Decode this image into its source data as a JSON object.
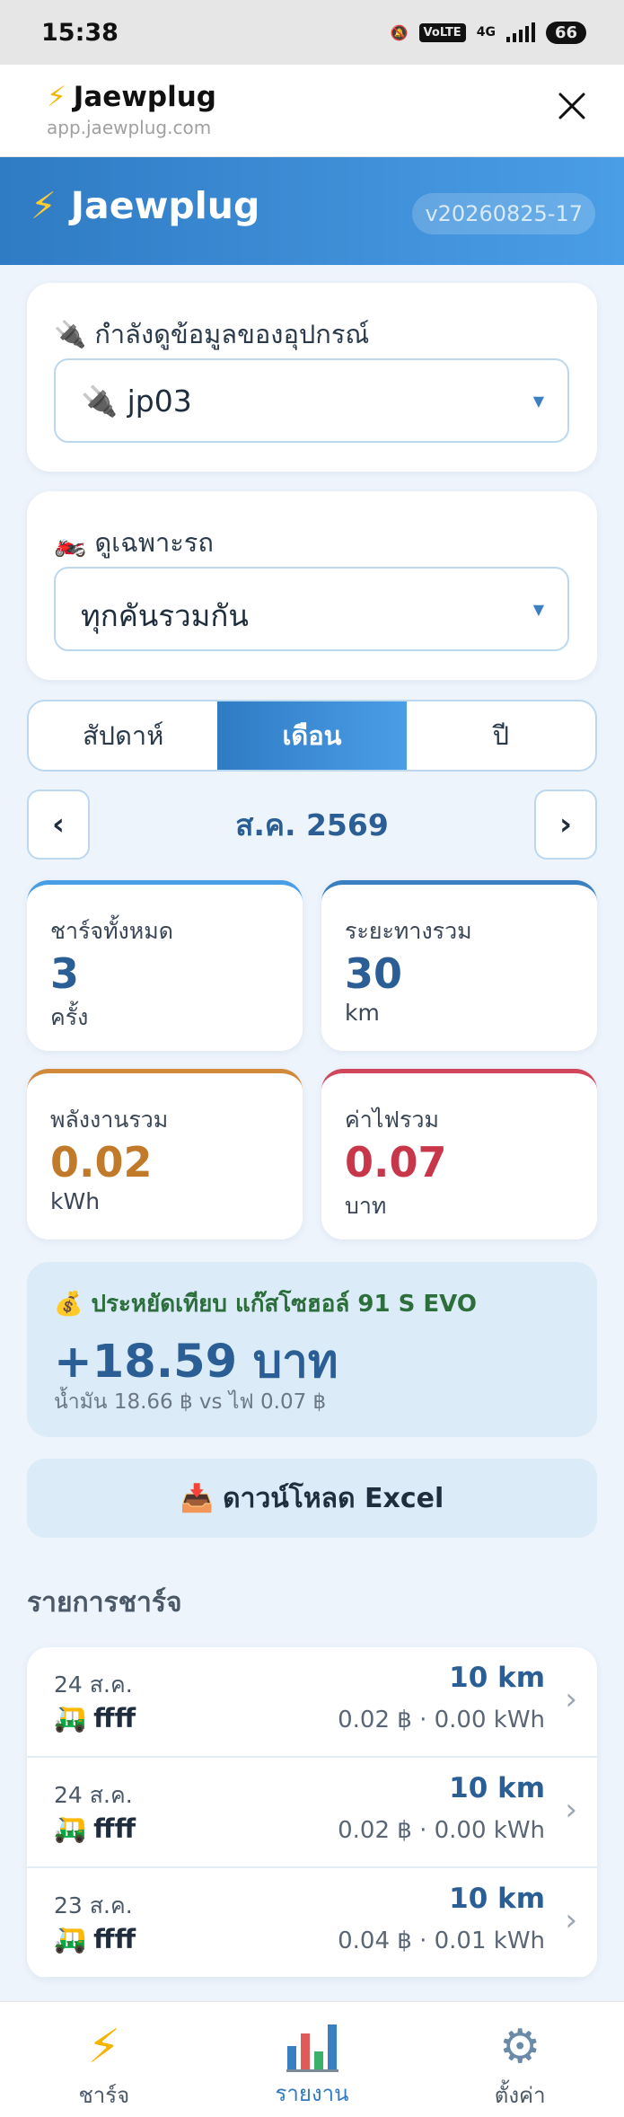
{
  "status_bar": {
    "time": "15:38",
    "network": "4G",
    "volte": "VoLTE",
    "battery": "66"
  },
  "browser": {
    "title": "Jaewplug",
    "url": "app.jaewplug.com"
  },
  "app_header": {
    "title": "Jaewplug",
    "version": "v20260825-17"
  },
  "device_card": {
    "label": "กำลังดูข้อมูลของอุปกรณ์",
    "selected": "jp03"
  },
  "vehicle_card": {
    "label": "ดูเฉพาะรถ",
    "selected": "ทุกคันรวมกัน"
  },
  "period_tabs": [
    {
      "label": "สัปดาห์",
      "active": false
    },
    {
      "label": "เดือน",
      "active": true
    },
    {
      "label": "ปี",
      "active": false
    }
  ],
  "month_nav": {
    "prev": "‹",
    "label": "ส.ค. 2569",
    "next": "›"
  },
  "stats": {
    "charges": {
      "label": "ชาร์จทั้งหมด",
      "value": "3",
      "unit": "ครั้ง",
      "color": "#2a5e94"
    },
    "distance": {
      "label": "ระยะทางรวม",
      "value": "30",
      "unit": "km",
      "color": "#2a5e94"
    },
    "energy": {
      "label": "พลังงานรวม",
      "value": "0.02",
      "unit": "kWh",
      "color": "#c07a2a"
    },
    "cost": {
      "label": "ค่าไฟรวม",
      "value": "0.07",
      "unit": "บาท",
      "color": "#c8364a"
    }
  },
  "savings": {
    "title": "ประหยัดเทียบ แก๊สโซฮอล์ 91 S EVO",
    "amount": "+18.59 บาท",
    "detail": "น้ำมัน 18.66 ฿ vs ไฟ 0.07 ฿"
  },
  "download": {
    "label": "ดาวน์โหลด Excel"
  },
  "charge_list": {
    "title": "รายการชาร์จ",
    "items": [
      {
        "date": "24 ส.ค.",
        "vehicle": "ffff",
        "distance": "10 km",
        "detail": "0.02 ฿ · 0.00 kWh"
      },
      {
        "date": "24 ส.ค.",
        "vehicle": "ffff",
        "distance": "10 km",
        "detail": "0.02 ฿ · 0.00 kWh"
      },
      {
        "date": "23 ส.ค.",
        "vehicle": "ffff",
        "distance": "10 km",
        "detail": "0.04 ฿ · 0.01 kWh"
      }
    ]
  },
  "bottom_nav": [
    {
      "label": "ชาร์จ",
      "icon": "lightning-icon",
      "active": false
    },
    {
      "label": "รายงาน",
      "icon": "bar-chart-icon",
      "active": true
    },
    {
      "label": "ตั้งค่า",
      "icon": "gear-icon",
      "active": false
    }
  ]
}
